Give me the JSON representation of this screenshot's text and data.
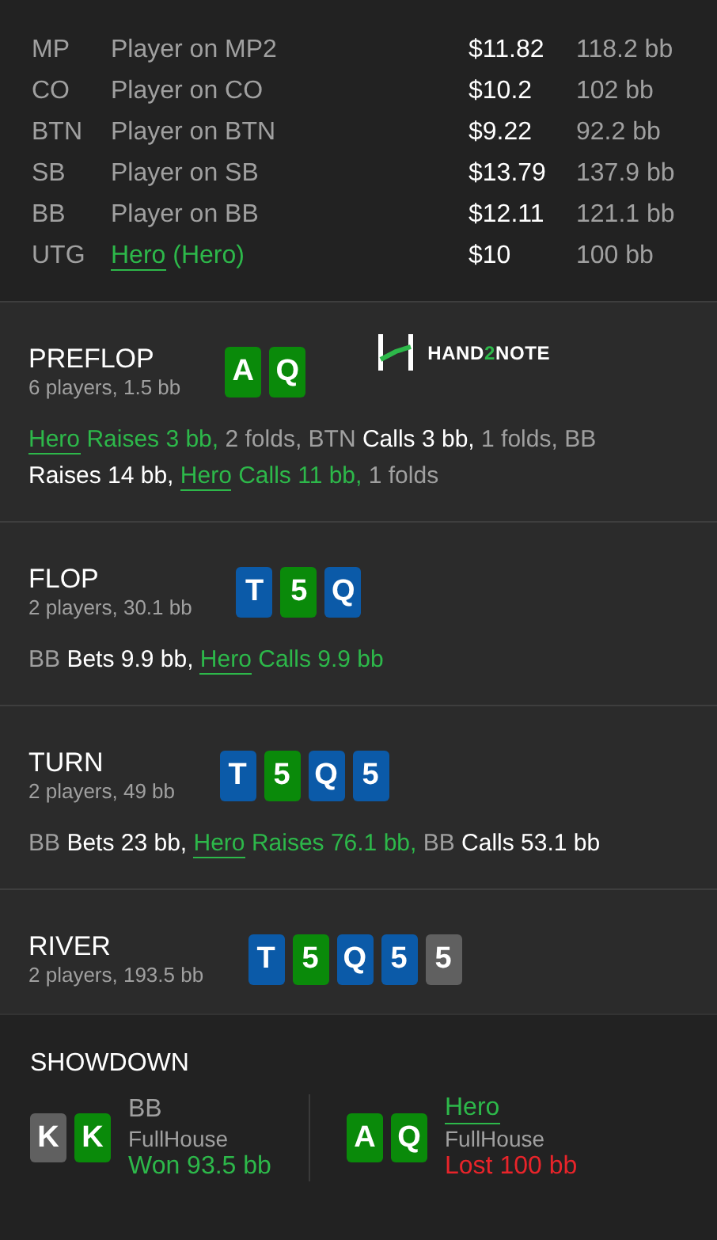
{
  "players": [
    {
      "position": "MP",
      "name": "Player on MP2",
      "hero": false,
      "stack": "$11.82",
      "bb": "118.2 bb"
    },
    {
      "position": "CO",
      "name": "Player on CO",
      "hero": false,
      "stack": "$10.2",
      "bb": "102 bb"
    },
    {
      "position": "BTN",
      "name": "Player on BTN",
      "hero": false,
      "stack": "$9.22",
      "bb": "92.2 bb"
    },
    {
      "position": "SB",
      "name": "Player on SB",
      "hero": false,
      "stack": "$13.79",
      "bb": "137.9 bb"
    },
    {
      "position": "BB",
      "name": "Player on BB",
      "hero": false,
      "stack": "$12.11",
      "bb": "121.1 bb"
    },
    {
      "position": "UTG",
      "name": "Hero",
      "tag": "(Hero)",
      "hero": true,
      "stack": "$10",
      "bb": "100 bb"
    }
  ],
  "streets": [
    {
      "title": "PREFLOP",
      "info": "6 players, 1.5 bb",
      "cards": [
        {
          "rank": "A",
          "color": "#0a8a0a"
        },
        {
          "rank": "Q",
          "color": "#0a8a0a"
        }
      ],
      "logo": [
        {
          "text": "HAND",
          "accent": false
        },
        {
          "text": "2",
          "accent": true
        },
        {
          "text": "NOTE",
          "accent": false
        }
      ],
      "actions": [
        {
          "kind": "hero",
          "text": "Hero"
        },
        {
          "kind": "hero_action",
          "text": "Raises 3 bb,"
        },
        {
          "kind": "note",
          "text": "2 folds,"
        },
        {
          "kind": "player",
          "text": "BTN"
        },
        {
          "kind": "action",
          "text": "Calls 3 bb,"
        },
        {
          "kind": "note",
          "text": "1 folds,"
        },
        {
          "kind": "player",
          "text": "BB"
        },
        {
          "kind": "action",
          "text": "Raises 14 bb,"
        },
        {
          "kind": "hero",
          "text": "Hero"
        },
        {
          "kind": "hero_action",
          "text": "Calls 11 bb,"
        },
        {
          "kind": "note",
          "text": "1 folds"
        }
      ]
    },
    {
      "title": "FLOP",
      "info": "2 players, 30.1 bb",
      "cards": [
        {
          "rank": "T",
          "color": "#0b5aa8"
        },
        {
          "rank": "5",
          "color": "#0a8a0a"
        },
        {
          "rank": "Q",
          "color": "#0b5aa8"
        }
      ],
      "actions": [
        {
          "kind": "player",
          "text": "BB"
        },
        {
          "kind": "action",
          "text": "Bets 9.9 bb,"
        },
        {
          "kind": "hero",
          "text": "Hero"
        },
        {
          "kind": "hero_action",
          "text": "Calls 9.9 bb"
        }
      ]
    },
    {
      "title": "TURN",
      "info": "2 players, 49 bb",
      "cards": [
        {
          "rank": "T",
          "color": "#0b5aa8"
        },
        {
          "rank": "5",
          "color": "#0a8a0a"
        },
        {
          "rank": "Q",
          "color": "#0b5aa8"
        },
        {
          "rank": "5",
          "color": "#0b5aa8"
        }
      ],
      "actions": [
        {
          "kind": "player",
          "text": "BB"
        },
        {
          "kind": "action",
          "text": "Bets 23 bb,"
        },
        {
          "kind": "hero",
          "text": "Hero"
        },
        {
          "kind": "hero_action",
          "text": "Raises 76.1 bb,"
        },
        {
          "kind": "player",
          "text": "BB"
        },
        {
          "kind": "action",
          "text": "Calls 53.1 bb"
        }
      ]
    },
    {
      "title": "RIVER",
      "info": "2 players, 193.5 bb",
      "cards": [
        {
          "rank": "T",
          "color": "#0b5aa8"
        },
        {
          "rank": "5",
          "color": "#0a8a0a"
        },
        {
          "rank": "Q",
          "color": "#0b5aa8"
        },
        {
          "rank": "5",
          "color": "#0b5aa8"
        },
        {
          "rank": "5",
          "color": "#606060"
        }
      ]
    }
  ],
  "showdown": {
    "title": "SHOWDOWN",
    "hands": [
      {
        "cards": [
          {
            "rank": "K",
            "color": "#606060"
          },
          {
            "rank": "K",
            "color": "#0a8a0a"
          }
        ],
        "player": "BB",
        "hero": false,
        "hand": "FullHouse",
        "result": "Won 93.5 bb",
        "won": true
      },
      {
        "cards": [
          {
            "rank": "A",
            "color": "#0a8a0a"
          },
          {
            "rank": "Q",
            "color": "#0a8a0a"
          }
        ],
        "player": "Hero",
        "hero": true,
        "hand": "FullHouse",
        "result": "Lost 100 bb",
        "won": false
      }
    ]
  }
}
